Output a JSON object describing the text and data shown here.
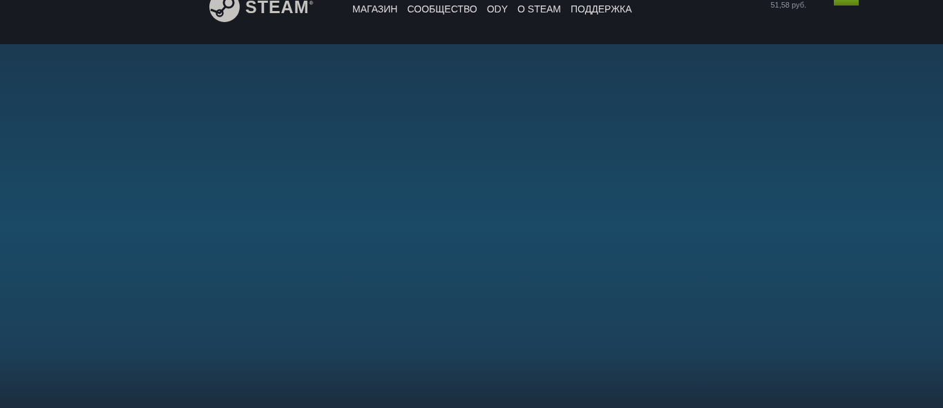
{
  "header": {
    "logo_text": "STEAM",
    "logo_mark": "®",
    "nav": [
      {
        "label": "МАГАЗИН"
      },
      {
        "label": "СООБЩЕСТВО"
      },
      {
        "label": "ODY"
      },
      {
        "label": "О STEAM"
      },
      {
        "label": "ПОДДЕРЖКА"
      }
    ],
    "wallet": "51,58 руб."
  }
}
